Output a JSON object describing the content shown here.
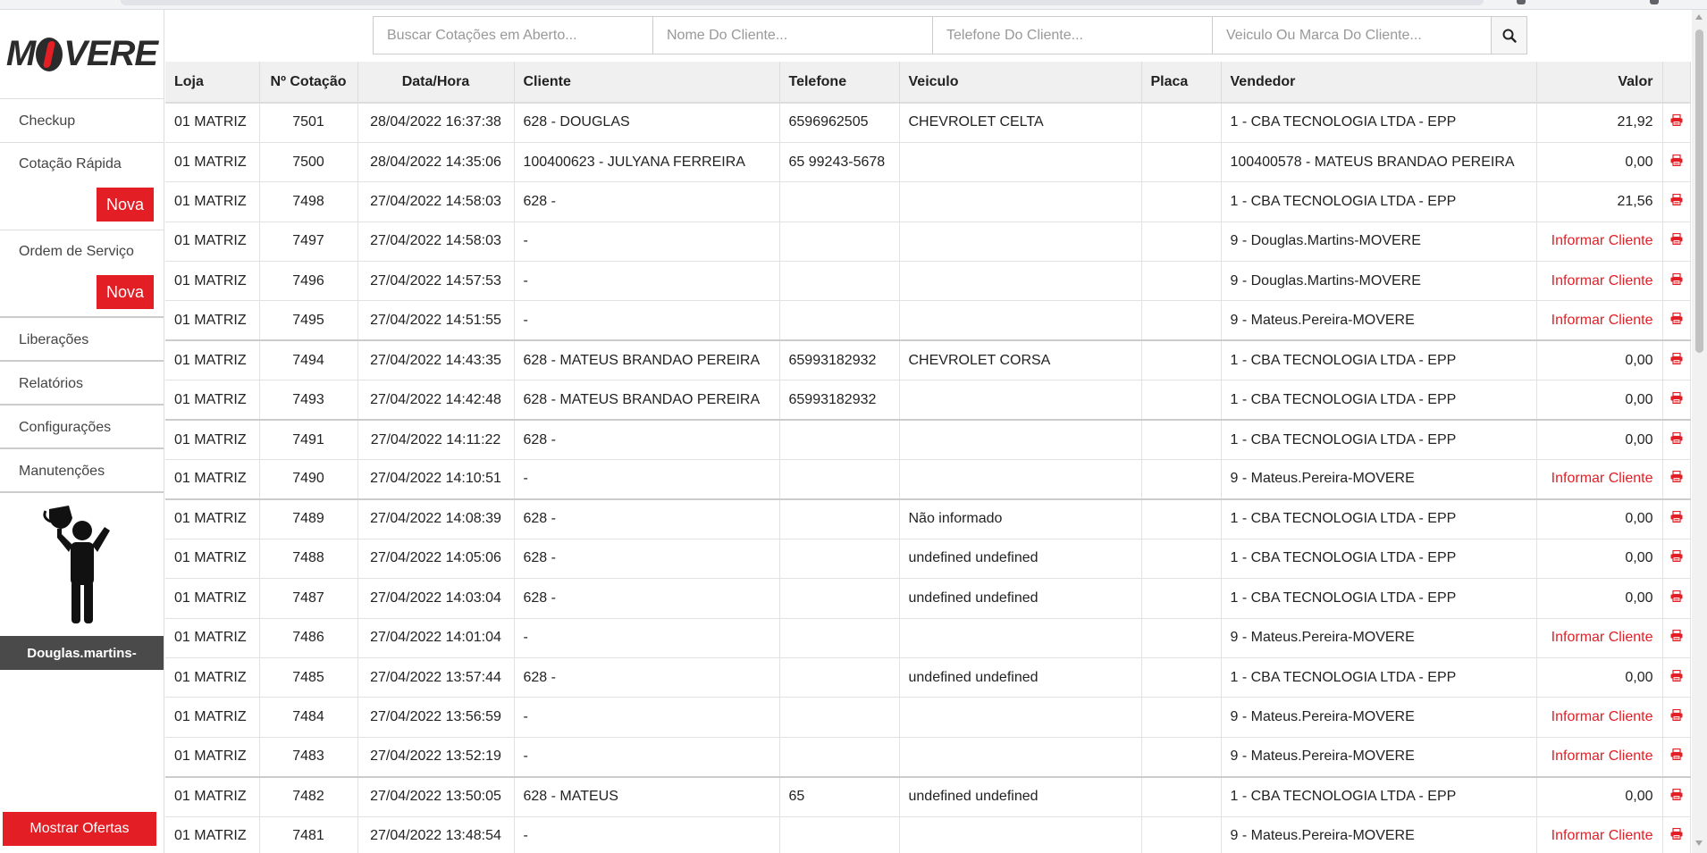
{
  "brand": {
    "logo_left": "M",
    "logo_right": "VERE"
  },
  "search": {
    "open_quotes_placeholder": "Buscar Cotações em Aberto...",
    "client_name_placeholder": "Nome Do Cliente...",
    "client_phone_placeholder": "Telefone Do Cliente...",
    "vehicle_placeholder": "Veiculo Ou Marca Do Cliente..."
  },
  "sidebar": {
    "checkup": "Checkup",
    "cotacao_rapida": "Cotação Rápida",
    "ordem_servico": "Ordem de Serviço",
    "nova_label": "Nova",
    "liberacoes": "Liberações",
    "relatorios": "Relatórios",
    "configuracoes": "Configurações",
    "manutencoes": "Manutenções",
    "user_name": "Douglas.martins-",
    "ofertas_button": "Mostrar Ofertas"
  },
  "table": {
    "headers": {
      "loja": "Loja",
      "cotacao": "Nº Cotação",
      "datahora": "Data/Hora",
      "cliente": "Cliente",
      "telefone": "Telefone",
      "veiculo": "Veiculo",
      "placa": "Placa",
      "vendedor": "Vendedor",
      "valor": "Valor"
    },
    "rows": [
      {
        "loja": "01 MATRIZ",
        "cotacao": "7501",
        "datahora": "28/04/2022 16:37:38",
        "cliente": "628 - DOUGLAS",
        "telefone": "6596962505",
        "veiculo": "CHEVROLET CELTA",
        "placa": "",
        "vendedor": "1 - CBA TECNOLOGIA LTDA - EPP",
        "valor": "21,92"
      },
      {
        "loja": "01 MATRIZ",
        "cotacao": "7500",
        "datahora": "28/04/2022 14:35:06",
        "cliente": "100400623 - JULYANA FERREIRA",
        "telefone": "65 99243-5678",
        "veiculo": "",
        "placa": "",
        "vendedor": "100400578 - MATEUS BRANDAO PEREIRA",
        "valor": "0,00"
      },
      {
        "loja": "01 MATRIZ",
        "cotacao": "7498",
        "datahora": "27/04/2022 14:58:03",
        "cliente": "628 -",
        "telefone": "",
        "veiculo": "",
        "placa": "",
        "vendedor": "1 - CBA TECNOLOGIA LTDA - EPP",
        "valor": "21,56"
      },
      {
        "loja": "01 MATRIZ",
        "cotacao": "7497",
        "datahora": "27/04/2022 14:58:03",
        "cliente": "-",
        "telefone": "",
        "veiculo": "",
        "placa": "",
        "vendedor": "9 - Douglas.Martins-MOVERE",
        "valor": "Informar Cliente"
      },
      {
        "loja": "01 MATRIZ",
        "cotacao": "7496",
        "datahora": "27/04/2022 14:57:53",
        "cliente": "-",
        "telefone": "",
        "veiculo": "",
        "placa": "",
        "vendedor": "9 - Douglas.Martins-MOVERE",
        "valor": "Informar Cliente"
      },
      {
        "loja": "01 MATRIZ",
        "cotacao": "7495",
        "datahora": "27/04/2022 14:51:55",
        "cliente": "-",
        "telefone": "",
        "veiculo": "",
        "placa": "",
        "vendedor": "9 - Mateus.Pereira-MOVERE",
        "valor": "Informar Cliente"
      },
      {
        "loja": "01 MATRIZ",
        "cotacao": "7494",
        "datahora": "27/04/2022 14:43:35",
        "cliente": "628 - MATEUS BRANDAO PEREIRA",
        "telefone": "65993182932",
        "veiculo": "CHEVROLET CORSA",
        "placa": "",
        "vendedor": "1 - CBA TECNOLOGIA LTDA - EPP",
        "valor": "0,00"
      },
      {
        "loja": "01 MATRIZ",
        "cotacao": "7493",
        "datahora": "27/04/2022 14:42:48",
        "cliente": "628 - MATEUS BRANDAO PEREIRA",
        "telefone": "65993182932",
        "veiculo": "",
        "placa": "",
        "vendedor": "1 - CBA TECNOLOGIA LTDA - EPP",
        "valor": "0,00"
      },
      {
        "loja": "01 MATRIZ",
        "cotacao": "7491",
        "datahora": "27/04/2022 14:11:22",
        "cliente": "628 -",
        "telefone": "",
        "veiculo": "",
        "placa": "",
        "vendedor": "1 - CBA TECNOLOGIA LTDA - EPP",
        "valor": "0,00"
      },
      {
        "loja": "01 MATRIZ",
        "cotacao": "7490",
        "datahora": "27/04/2022 14:10:51",
        "cliente": "-",
        "telefone": "",
        "veiculo": "",
        "placa": "",
        "vendedor": "9 - Mateus.Pereira-MOVERE",
        "valor": "Informar Cliente"
      },
      {
        "loja": "01 MATRIZ",
        "cotacao": "7489",
        "datahora": "27/04/2022 14:08:39",
        "cliente": "628 -",
        "telefone": "",
        "veiculo": "Não informado",
        "placa": "",
        "vendedor": "1 - CBA TECNOLOGIA LTDA - EPP",
        "valor": "0,00"
      },
      {
        "loja": "01 MATRIZ",
        "cotacao": "7488",
        "datahora": "27/04/2022 14:05:06",
        "cliente": "628 -",
        "telefone": "",
        "veiculo": "undefined undefined",
        "placa": "",
        "vendedor": "1 - CBA TECNOLOGIA LTDA - EPP",
        "valor": "0,00"
      },
      {
        "loja": "01 MATRIZ",
        "cotacao": "7487",
        "datahora": "27/04/2022 14:03:04",
        "cliente": "628 -",
        "telefone": "",
        "veiculo": "undefined undefined",
        "placa": "",
        "vendedor": "1 - CBA TECNOLOGIA LTDA - EPP",
        "valor": "0,00"
      },
      {
        "loja": "01 MATRIZ",
        "cotacao": "7486",
        "datahora": "27/04/2022 14:01:04",
        "cliente": "-",
        "telefone": "",
        "veiculo": "",
        "placa": "",
        "vendedor": "9 - Mateus.Pereira-MOVERE",
        "valor": "Informar Cliente"
      },
      {
        "loja": "01 MATRIZ",
        "cotacao": "7485",
        "datahora": "27/04/2022 13:57:44",
        "cliente": "628 -",
        "telefone": "",
        "veiculo": "undefined undefined",
        "placa": "",
        "vendedor": "1 - CBA TECNOLOGIA LTDA - EPP",
        "valor": "0,00"
      },
      {
        "loja": "01 MATRIZ",
        "cotacao": "7484",
        "datahora": "27/04/2022 13:56:59",
        "cliente": "-",
        "telefone": "",
        "veiculo": "",
        "placa": "",
        "vendedor": "9 - Mateus.Pereira-MOVERE",
        "valor": "Informar Cliente"
      },
      {
        "loja": "01 MATRIZ",
        "cotacao": "7483",
        "datahora": "27/04/2022 13:52:19",
        "cliente": "-",
        "telefone": "",
        "veiculo": "",
        "placa": "",
        "vendedor": "9 - Mateus.Pereira-MOVERE",
        "valor": "Informar Cliente"
      },
      {
        "loja": "01 MATRIZ",
        "cotacao": "7482",
        "datahora": "27/04/2022 13:50:05",
        "cliente": "628 - MATEUS",
        "telefone": "65",
        "veiculo": "undefined undefined",
        "placa": "",
        "vendedor": "1 - CBA TECNOLOGIA LTDA - EPP",
        "valor": "0,00"
      },
      {
        "loja": "01 MATRIZ",
        "cotacao": "7481",
        "datahora": "27/04/2022 13:48:54",
        "cliente": "-",
        "telefone": "",
        "veiculo": "",
        "placa": "",
        "vendedor": "9 - Mateus.Pereira-MOVERE",
        "valor": "Informar Cliente"
      }
    ]
  },
  "icons": {
    "search": "search-icon",
    "print": "print-icon"
  },
  "colors": {
    "accent": "#e31e24",
    "header_bg": "#f0f0f0",
    "user_bar": "#4a4a4a"
  }
}
